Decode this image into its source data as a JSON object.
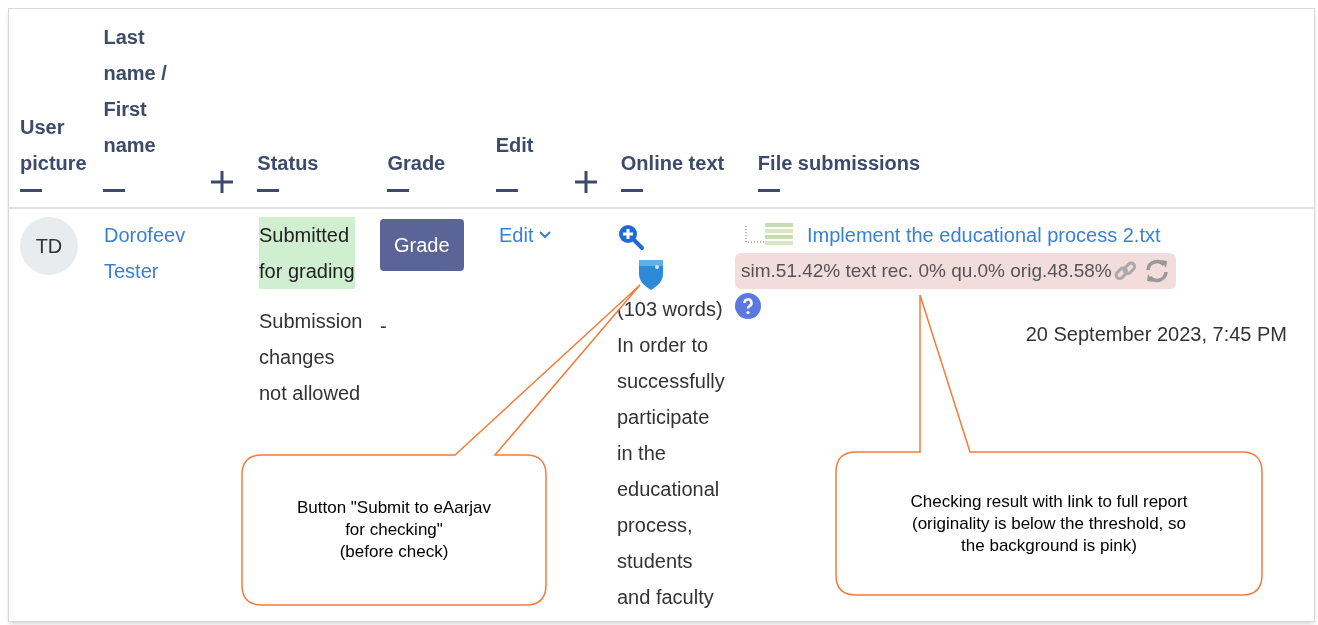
{
  "table": {
    "columns": [
      {
        "label": "User picture",
        "expandable": false
      },
      {
        "label": "Last name / First name",
        "expandable": true
      },
      {
        "label": "Status",
        "expandable": false
      },
      {
        "label": "Grade",
        "expandable": false
      },
      {
        "label": "Edit",
        "expandable": true
      },
      {
        "label": "Online text",
        "expandable": false
      },
      {
        "label": "File submissions",
        "expandable": false
      }
    ],
    "rows": [
      {
        "initials": "TD",
        "name_lines": [
          "Dorofeev",
          "Tester"
        ],
        "status": {
          "submission": [
            "Submitted",
            "for grading"
          ],
          "changes": [
            "Submission",
            "changes",
            "not allowed"
          ]
        },
        "grade_button": "Grade",
        "grade": "-",
        "edit": "Edit",
        "online_text": {
          "word_count": "(103 words)",
          "lines": [
            "In order to",
            "successfully",
            "participate",
            "in the",
            "educational",
            "process,",
            "students",
            "and faculty"
          ]
        },
        "file": {
          "name": "Implement the educational process 2.txt",
          "result": "sim.51.42% text rec. 0% qu.0% orig.48.58%",
          "below_threshold": true,
          "date": "20 September 2023, 7:45 PM"
        }
      }
    ]
  },
  "callouts": [
    {
      "lines": [
        "Button \"Submit to eAarjav",
        "for checking\"",
        "(before check)"
      ]
    },
    {
      "lines": [
        "Checking result with link to full report",
        "(originality is below the threshold, so",
        "the background is pink)"
      ]
    }
  ]
}
